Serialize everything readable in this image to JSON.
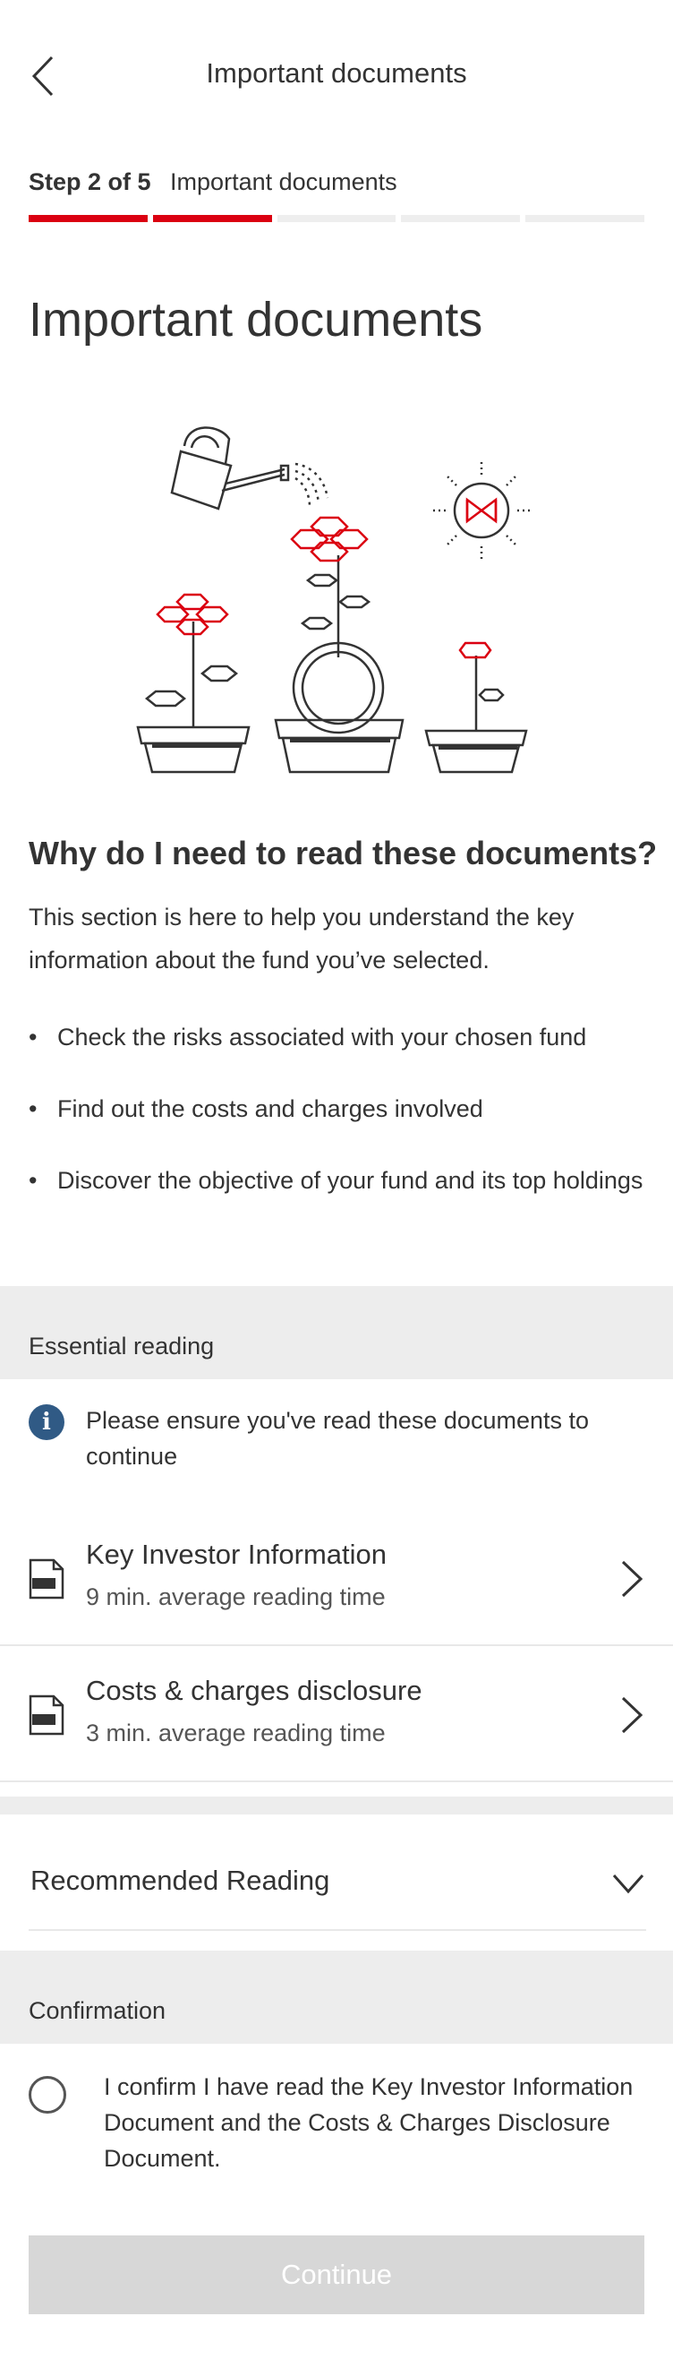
{
  "nav": {
    "title": "Important documents",
    "back_icon": "chevron-left-icon"
  },
  "progress": {
    "step_label": "Step 2 of 5",
    "step_name": "Important documents",
    "total_steps": 5,
    "completed_steps": 2,
    "accent": "#db0011"
  },
  "page": {
    "title": "Important documents"
  },
  "why": {
    "heading": "Why do I need to read these documents?",
    "body": "This section is here to help you understand the key information about the fund you’ve selected.",
    "bullets": [
      "Check the risks associated with your chosen fund",
      "Find out the costs and charges involved",
      "Discover the objective of your fund and its top holdings"
    ]
  },
  "essential": {
    "label": "Essential reading",
    "info": "Please ensure you've read these documents to continue",
    "docs": [
      {
        "title": "Key Investor Information",
        "subtitle": "9 min. average reading time"
      },
      {
        "title": "Costs & charges disclosure",
        "subtitle": "3 min. average reading time"
      }
    ]
  },
  "recommended": {
    "label": "Recommended Reading"
  },
  "confirmation": {
    "label": "Confirmation",
    "text": "I confirm I have read the Key Investor Information Document and the Costs & Charges Disclosure Document.",
    "checked": false
  },
  "continue": {
    "label": "Continue",
    "enabled": false
  },
  "colors": {
    "info_blue": "#305a85",
    "band_grey": "#ededed",
    "disabled_grey": "#d7d7d7"
  }
}
